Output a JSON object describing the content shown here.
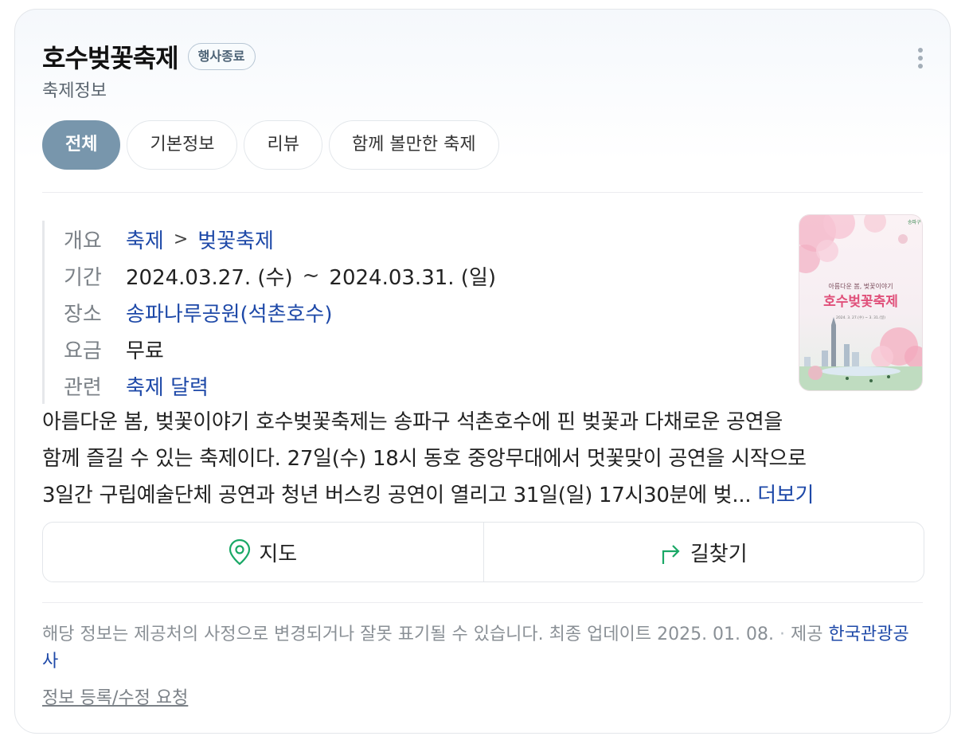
{
  "header": {
    "title": "호수벚꽃축제",
    "badge": "행사종료",
    "subtitle": "축제정보"
  },
  "tabs": [
    {
      "label": "전체",
      "active": true
    },
    {
      "label": "기본정보"
    },
    {
      "label": "리뷰"
    },
    {
      "label": "함께 볼만한 축제"
    }
  ],
  "info": {
    "overview": {
      "label": "개요",
      "category": "축제",
      "separator": ">",
      "subcategory": "벚꽃축제"
    },
    "period": {
      "label": "기간",
      "start": "2024.03.27. (수)",
      "tilde": "~",
      "end": "2024.03.31. (일)"
    },
    "place": {
      "label": "장소",
      "value": "송파나루공원(석촌호수)"
    },
    "fee": {
      "label": "요금",
      "value": "무료"
    },
    "related": {
      "label": "관련",
      "value": "축제 달력"
    }
  },
  "poster": {
    "org": "송파구",
    "tagline": "아름다운 봄, 벚꽃이야기",
    "title": "호수벚꽃축제",
    "dates": "2024. 3. 27.(수) ~ 3. 31.(일)"
  },
  "description": {
    "line1": "아름다운 봄, 벚꽃이야기 호수벚꽃축제는 송파구 석촌호수에 핀 벚꽃과 다채로운 공연을",
    "line2": "함께 즐길 수 있는 축제이다. 27일(수) 18시 동호 중앙무대에서 멋꽃맞이 공연을 시작으로",
    "line3": "3일간 구립예술단체 공연과 청년 버스킹 공연이 열리고 31일(일) 17시30분에 벚...",
    "more": "더보기"
  },
  "actions": {
    "map": "지도",
    "directions": "길찾기"
  },
  "footer": {
    "notice": "해당 정보는 제공처의 사정으로 변경되거나 잘못 표기될 수 있습니다. 최종 업데이트 2025. 01. 08.",
    "provider_label": "제공",
    "provider": "한국관광공사",
    "request": "정보 등록/수정 요청"
  },
  "colors": {
    "accent_tab": "#7896ac",
    "link": "#1e49a8",
    "map_icon": "#1aa866"
  }
}
